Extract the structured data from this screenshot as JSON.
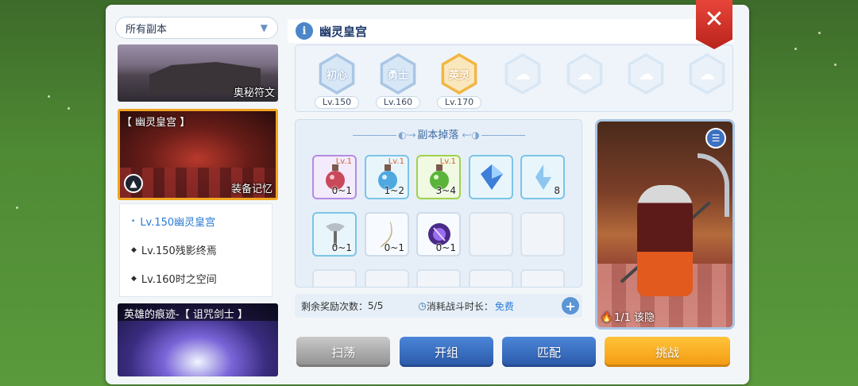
{
  "filter": {
    "label": "所有副本"
  },
  "cards": [
    {
      "tag": "奥秘符文"
    },
    {
      "title": "【 幽灵皇宫 】",
      "tag": "装备记忆"
    },
    {
      "title": "英雄的痕迹-【 诅咒剑士 】"
    }
  ],
  "sub_levels": [
    {
      "label": "Lv.150幽灵皇宫",
      "active": true
    },
    {
      "label": "Lv.150残影终焉",
      "active": false
    },
    {
      "label": "Lv.160时之空间",
      "active": false
    }
  ],
  "dungeon": {
    "name": "幽灵皇宫",
    "info_glyph": "i"
  },
  "difficulties": [
    {
      "name": "初心",
      "level": "Lv.150",
      "state": "normal"
    },
    {
      "name": "勇士",
      "level": "Lv.160",
      "state": "normal"
    },
    {
      "name": "英灵",
      "level": "Lv.170",
      "state": "selected"
    },
    {
      "name": "",
      "level": "",
      "state": "locked"
    },
    {
      "name": "",
      "level": "",
      "state": "locked"
    },
    {
      "name": "",
      "level": "",
      "state": "locked"
    },
    {
      "name": "",
      "level": "",
      "state": "locked"
    }
  ],
  "drops": {
    "title": "副本掉落",
    "items": [
      {
        "icon": "red-potion-icon",
        "qty": "0~1",
        "lv": "Lv.1",
        "rarity": "purple"
      },
      {
        "icon": "blue-potion-icon",
        "qty": "1~2",
        "lv": "Lv.1",
        "rarity": "blue"
      },
      {
        "icon": "green-potion-icon",
        "qty": "3~4",
        "lv": "Lv.1",
        "rarity": "green"
      },
      {
        "icon": "blue-crystal-icon",
        "qty": "",
        "lv": "",
        "rarity": "blue"
      },
      {
        "icon": "ice-crystal-icon",
        "qty": "8",
        "lv": "",
        "rarity": "blue"
      },
      {
        "icon": "axe-icon",
        "qty": "0~1",
        "lv": "",
        "rarity": "blue"
      },
      {
        "icon": "horn-icon",
        "qty": "0~1",
        "lv": "",
        "rarity": "plain"
      },
      {
        "icon": "purple-orb-icon",
        "qty": "0~1",
        "lv": "",
        "rarity": "plain"
      },
      {
        "icon": "",
        "qty": "",
        "lv": "",
        "rarity": "empty"
      },
      {
        "icon": "",
        "qty": "",
        "lv": "",
        "rarity": "empty"
      }
    ]
  },
  "rewards": {
    "remaining_label": "剩余奖励次数：",
    "remaining_value": "5/5",
    "cost_label": "消耗战斗时长：",
    "cost_value": "免费",
    "plus": "+"
  },
  "boss": {
    "status": "1/1 该隐"
  },
  "buttons": {
    "sweep": "扫荡",
    "group": "开组",
    "match": "匹配",
    "challenge": "挑战"
  },
  "close": "✕"
}
